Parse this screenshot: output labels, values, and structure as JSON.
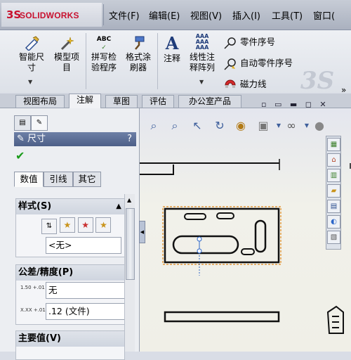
{
  "app": {
    "logo_mark": "3S",
    "logo_text": "SOLIDWORKS"
  },
  "menu": [
    {
      "label": "文件(F)"
    },
    {
      "label": "编辑(E)"
    },
    {
      "label": "视图(V)"
    },
    {
      "label": "插入(I)"
    },
    {
      "label": "工具(T)"
    },
    {
      "label": "窗口("
    }
  ],
  "ribbon": {
    "smart_dim_line1": "智能尺",
    "smart_dim_line2": "寸",
    "model_items_line1": "模型项",
    "model_items_line2": "目",
    "spell_line1": "拼写检",
    "spell_line2": "验程序",
    "format_line1": "格式涂",
    "format_line2": "刷器",
    "note": "注释",
    "linear_note_line1": "线性注",
    "linear_note_line2": "释阵列",
    "balloon": "零件序号",
    "auto_balloon": "自动零件序号",
    "magnetic_line": "磁力线",
    "abc_icon": "ABC",
    "aaa_icon": "AAA"
  },
  "tabs": [
    {
      "label": "视图布局"
    },
    {
      "label": "注解"
    },
    {
      "label": "草图"
    },
    {
      "label": "评估"
    },
    {
      "label": "办公室产品"
    }
  ],
  "panel": {
    "title": "尺寸",
    "help": "?",
    "subtabs": [
      {
        "label": "数值"
      },
      {
        "label": "引线"
      },
      {
        "label": "其它"
      }
    ],
    "style_title": "样式(S)",
    "style_value": "<无>",
    "tolerance_title": "公差/精度(P)",
    "tolerance_value": "无",
    "precision_value": ".12 (文件)",
    "primary_title": "主要值(V)",
    "tol_icon_text": "1.50 +.01 -.01",
    "prec_icon_text": "X.XX +.01"
  },
  "colors": {
    "brand": "#c8102e",
    "check": "#1a9b1a",
    "header": "#4d5f88"
  },
  "icons": [
    "wrench-icon",
    "magic-wand-icon",
    "spellcheck-icon",
    "format-painter-icon",
    "note-icon",
    "pattern-icon",
    "balloon-icon",
    "auto-balloon-icon",
    "magnet-icon",
    "zoom-fit-icon",
    "zoom-area-icon",
    "previous-view-icon",
    "rotate-icon",
    "section-view-icon",
    "view-orientation-icon",
    "display-style-icon",
    "hide-show-icon",
    "appearance-icon"
  ]
}
